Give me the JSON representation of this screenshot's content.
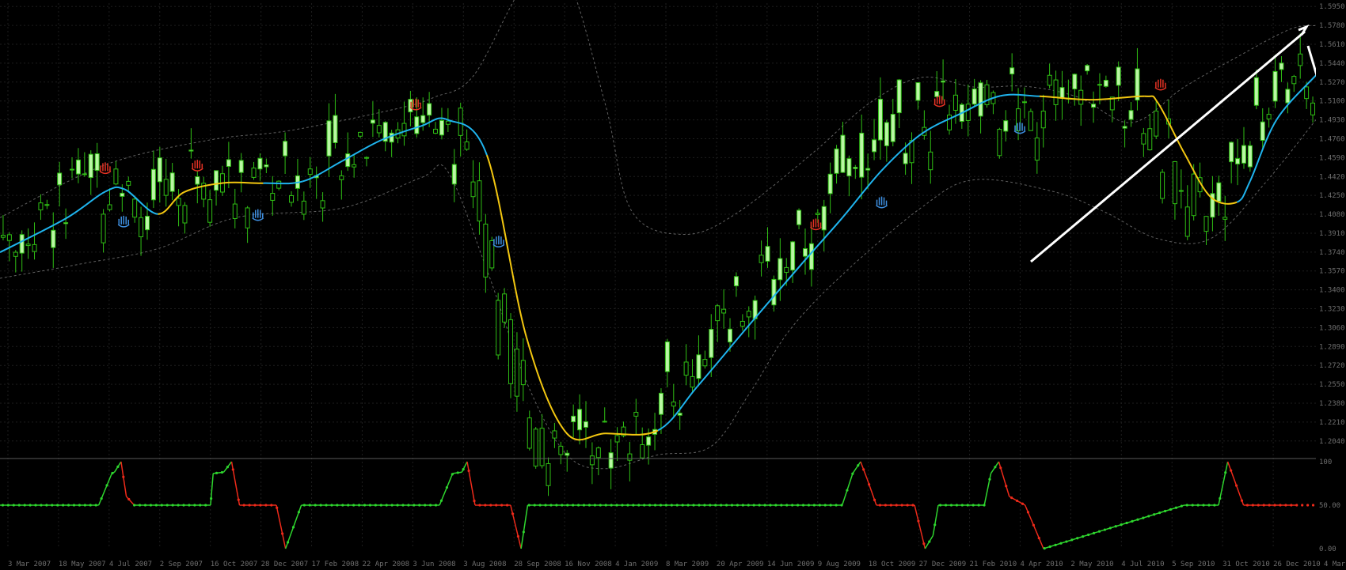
{
  "colors": {
    "background": "#000000",
    "grid": "#1e1e1e",
    "separator": "#5a5a5a",
    "bull_candle": "#baf7a4",
    "wick": "#2fbf14",
    "bear_candle": "#000000",
    "ma_up": "#1fb4ee",
    "ma_down": "#f3c710",
    "band": "#8a8a8a",
    "osc_up": "#2ed62e",
    "osc_down": "#ee2a1a",
    "top_marker": "#e43224",
    "bottom_marker": "#3e8fe0",
    "annotation": "#ffffff",
    "label_text": "#6e6e6e"
  },
  "icons": {
    "top_marker": "red-hand-icon",
    "bottom_marker": "blue-hand-icon"
  },
  "chart_data": [
    {
      "type": "candlestick",
      "title": "",
      "x_tick_labels": [
        "3 Mar 2007",
        "18 May 2007",
        "4 Jul 2007",
        "2 Sep 2007",
        "16 Oct 2007",
        "28 Dec 2007",
        "17 Feb 2008",
        "22 Apr 2008",
        "3 Jun 2008",
        "3 Aug 2008",
        "28 Sep 2008",
        "16 Nov 2008",
        "4 Jan 2009",
        "8 Mar 2009",
        "20 Apr 2009",
        "14 Jun 2009",
        "9 Aug 2009",
        "18 Oct 2009",
        "27 Dec 2009",
        "21 Feb 2010",
        "4 Apr 2010",
        "2 May 2010",
        "4 Jul 2010",
        "5 Sep 2010",
        "31 Oct 2010",
        "26 Dec 2010",
        "4 Mar 2011"
      ],
      "y_tick_labels": [
        "1.5950",
        "1.5780",
        "1.5610",
        "1.5440",
        "1.5270",
        "1.5100",
        "1.4930",
        "1.4760",
        "1.4590",
        "1.4420",
        "1.4250",
        "1.4080",
        "1.3910",
        "1.3740",
        "1.3570",
        "1.3400",
        "1.3230",
        "1.3060",
        "1.2890",
        "1.2720",
        "1.2550",
        "1.2380",
        "1.2210",
        "1.2040"
      ],
      "ylim": [
        1.201,
        1.598
      ],
      "series": [
        {
          "kind": "smoothed_ma",
          "color_up": "#1fb4ee",
          "color_down": "#f3c710",
          "x_fraction": [
            0.0,
            0.05,
            0.08,
            0.095,
            0.12,
            0.14,
            0.17,
            0.2,
            0.23,
            0.26,
            0.29,
            0.32,
            0.34,
            0.37,
            0.4,
            0.43,
            0.46,
            0.5,
            0.53,
            0.57,
            0.61,
            0.64,
            0.67,
            0.7,
            0.73,
            0.76,
            0.79,
            0.83,
            0.87,
            0.88,
            0.9,
            0.92,
            0.94,
            0.95,
            0.97,
            1.0
          ],
          "y": [
            1.3738,
            1.4042,
            1.4284,
            1.4303,
            1.4082,
            1.428,
            1.4362,
            1.436,
            1.4376,
            1.4559,
            1.4749,
            1.4874,
            1.4931,
            1.4612,
            1.2976,
            1.2118,
            1.2108,
            1.2135,
            1.2531,
            1.3093,
            1.3644,
            1.4047,
            1.4474,
            1.4801,
            1.4986,
            1.5145,
            1.5142,
            1.5111,
            1.5142,
            1.5081,
            1.463,
            1.4236,
            1.4189,
            1.4379,
            1.4929,
            1.5331
          ],
          "trend": [
            "up",
            "up",
            "up",
            "up",
            "down",
            "down",
            "down",
            "up",
            "up",
            "up",
            "up",
            "up",
            "up",
            "down",
            "down",
            "down",
            "down",
            "up",
            "up",
            "up",
            "up",
            "up",
            "up",
            "up",
            "up",
            "up",
            "down",
            "down",
            "down",
            "down",
            "down",
            "down",
            "up",
            "up",
            "up",
            "up"
          ]
        },
        {
          "kind": "band_upper",
          "color": "#8a8a8a",
          "x_fraction": [
            0.0,
            0.08,
            0.16,
            0.22,
            0.3,
            0.33,
            0.36,
            0.4,
            0.43,
            0.46,
            0.48,
            0.52,
            0.56,
            0.62,
            0.66,
            0.7,
            0.74,
            0.78,
            0.82,
            0.86,
            0.9,
            0.94,
            0.98,
            1.0
          ],
          "y": [
            1.405,
            1.4525,
            1.475,
            1.4833,
            1.5026,
            1.5133,
            1.533,
            1.6174,
            1.623,
            1.507,
            1.4109,
            1.3899,
            1.409,
            1.4655,
            1.5074,
            1.5311,
            1.5226,
            1.5231,
            1.5131,
            1.4905,
            1.5226,
            1.5495,
            1.5744,
            1.5779
          ]
        },
        {
          "kind": "band_lower",
          "color": "#8a8a8a",
          "x_fraction": [
            0.0,
            0.06,
            0.12,
            0.18,
            0.26,
            0.32,
            0.34,
            0.37,
            0.4,
            0.43,
            0.46,
            0.5,
            0.54,
            0.57,
            0.6,
            0.64,
            0.7,
            0.74,
            0.8,
            0.84,
            0.88,
            0.92,
            0.96,
            1.0
          ],
          "y": [
            1.3504,
            1.363,
            1.3771,
            1.4052,
            1.4136,
            1.441,
            1.4469,
            1.3581,
            1.2575,
            1.1925,
            1.1791,
            1.1915,
            1.1989,
            1.2475,
            1.3036,
            1.3535,
            1.4139,
            1.439,
            1.4286,
            1.4098,
            1.386,
            1.3861,
            1.4342,
            1.493
          ]
        }
      ]
    },
    {
      "type": "line",
      "title": "",
      "y_tick_labels": [
        "100",
        "50.00",
        "0.00"
      ],
      "ylim": [
        0,
        100
      ],
      "x_fraction": [
        0.0,
        0.075,
        0.085,
        0.087,
        0.092,
        0.096,
        0.102,
        0.107,
        0.16,
        0.162,
        0.17,
        0.176,
        0.182,
        0.202,
        0.21,
        0.217,
        0.229,
        0.334,
        0.344,
        0.351,
        0.355,
        0.361,
        0.388,
        0.396,
        0.401,
        0.407,
        0.64,
        0.648,
        0.654,
        0.659,
        0.666,
        0.695,
        0.703,
        0.709,
        0.713,
        0.748,
        0.753,
        0.759,
        0.767,
        0.779,
        0.793,
        0.9,
        0.926,
        0.933,
        0.945,
        0.986
      ],
      "values": [
        50.0,
        50.0,
        86.5,
        88.0,
        100.0,
        60.0,
        50.0,
        50.0,
        50.0,
        86.5,
        88.0,
        100.0,
        50.0,
        50.0,
        50.0,
        0.0,
        50.0,
        50.0,
        86.5,
        88.0,
        100.0,
        50.0,
        50.0,
        0.0,
        50.0,
        50.0,
        50.0,
        86.5,
        100.0,
        80.0,
        50.0,
        50.0,
        0.0,
        15.0,
        50.0,
        50.0,
        86.5,
        100.0,
        60.0,
        50.0,
        0.0,
        50.0,
        50.0,
        100.0,
        50.0,
        50.0
      ],
      "segment_trend": [
        "up",
        "up",
        "up",
        "up",
        "down",
        "down",
        "up",
        "up",
        "up",
        "up",
        "up",
        "down",
        "down",
        "down",
        "down",
        "up",
        "up",
        "up",
        "up",
        "up",
        "down",
        "down",
        "down",
        "up",
        "up",
        "up",
        "up",
        "up",
        "down",
        "down",
        "down",
        "down",
        "up",
        "up",
        "up",
        "up",
        "up",
        "down",
        "down",
        "down",
        "up",
        "up",
        "up",
        "down",
        "down"
      ]
    }
  ]
}
